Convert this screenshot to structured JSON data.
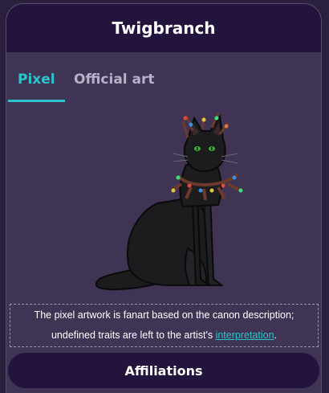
{
  "header": {
    "title": "Twigbranch"
  },
  "tabs": [
    {
      "label": "Pixel",
      "active": true
    },
    {
      "label": "Official art",
      "active": false
    }
  ],
  "artwork": {
    "subject": "cat-pixel-art",
    "colors": {
      "fur": "#1c1c1f",
      "eyes": "#3fae3a",
      "twigs": "#6b3a2a",
      "accent": "#2bc4c9"
    }
  },
  "disclaimer": {
    "text_part1": "The pixel artwork is fanart based on the canon description;",
    "text_part2": "undefined traits are left to the artist's ",
    "link": "interpretation",
    "end": "."
  },
  "section": {
    "affiliations_label": "Affiliations"
  },
  "theme": {
    "card_bg": "#3f3454",
    "header_bg": "#22143d",
    "accent": "#2bc4c9",
    "page_bg": "#2a1f3d"
  }
}
